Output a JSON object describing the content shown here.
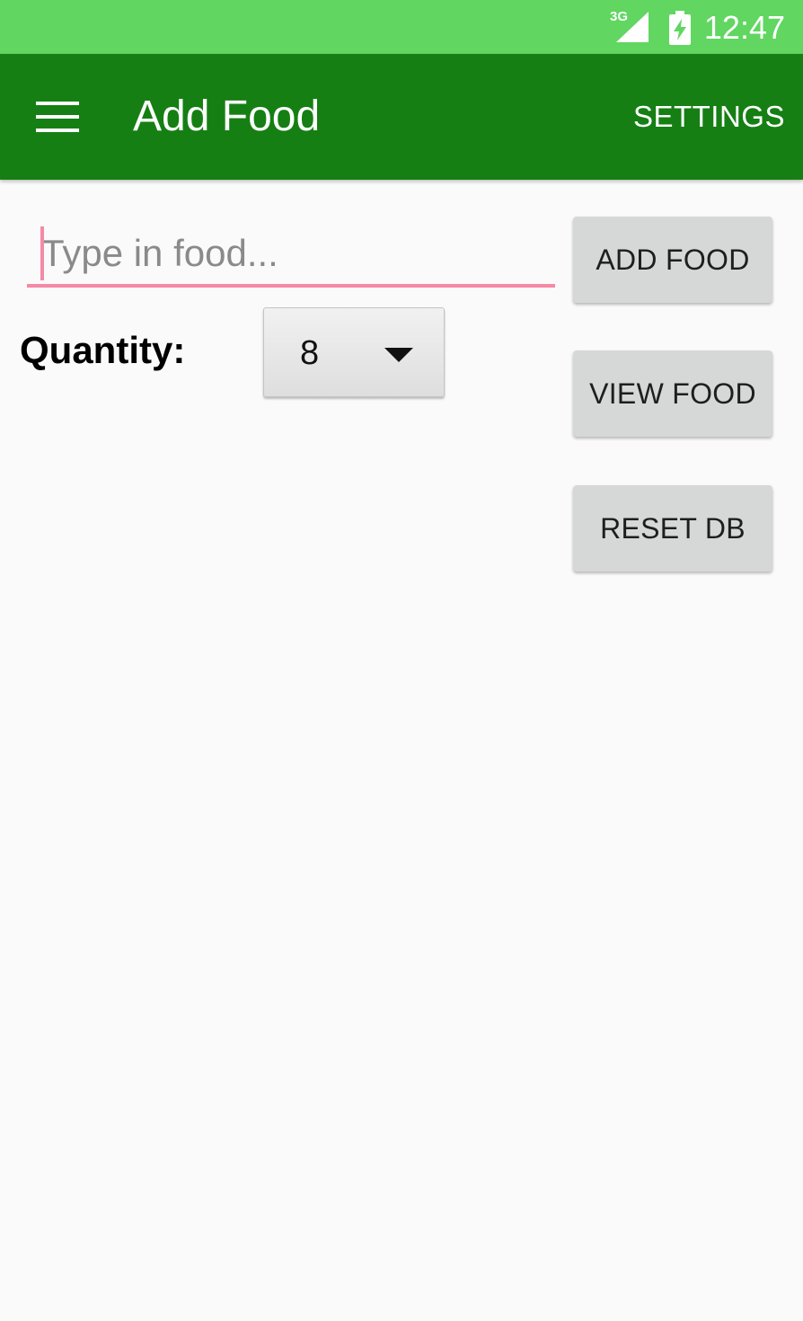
{
  "status_bar": {
    "network": "3G",
    "time": "12:47",
    "icons": [
      "signal-icon",
      "battery-charging-icon"
    ]
  },
  "app_bar": {
    "title": "Add Food",
    "menu_icon": "hamburger-menu-icon",
    "settings_label": "SETTINGS"
  },
  "form": {
    "food_input": {
      "placeholder": "Type in food...",
      "value": ""
    },
    "quantity_label": "Quantity:",
    "quantity_value": "8",
    "quantity_caret_icon": "dropdown-arrow-icon"
  },
  "buttons": {
    "add_food": "ADD FOOD",
    "view_food": "VIEW FOOD",
    "reset_db": "RESET DB"
  },
  "colors": {
    "status_bar": "#61d661",
    "app_bar": "#157f13",
    "input_accent": "#f48aa6",
    "background": "#fafafa",
    "button_bg": "#d6d7d7"
  }
}
